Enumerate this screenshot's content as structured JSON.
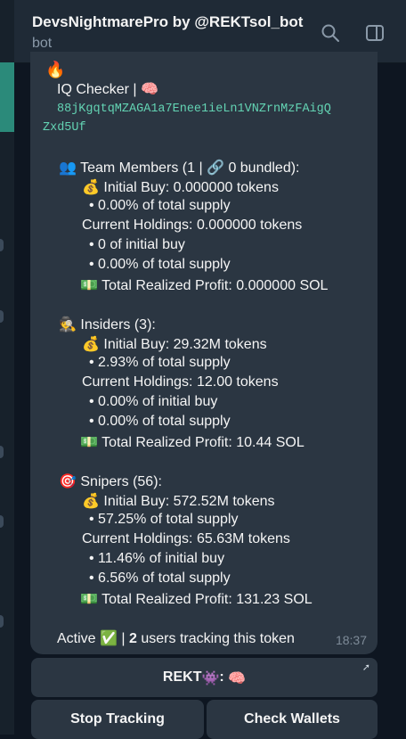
{
  "chat": {
    "title": "DevsNightmarePro by @REKTsol_bot",
    "subtitle": "bot"
  },
  "message": {
    "top_emoji": "🔥",
    "header": "IQ Checker  |",
    "header_emoji": "🧠",
    "address_line1": "88jKgqtqMZAGA1a7Enee1ieLn1VNZrnMzFAigQ",
    "address_line2": "Zxd5Uf",
    "team": {
      "icon": "👥",
      "title": "Team Members (1 |",
      "link_icon": "🔗",
      "title_tail": "0 bundled):",
      "buy_icon": "💰",
      "initial_buy": "Initial Buy: 0.000000 tokens",
      "initial_pct": "• 0.00% of total supply",
      "holdings": "Current Holdings: 0.000000 tokens",
      "hold_initial": "• 0 of initial buy",
      "hold_pct": "• 0.00% of total supply",
      "profit_icon": "💵",
      "profit": "Total Realized Profit: 0.000000 SOL"
    },
    "insiders": {
      "icon": "🕵",
      "title": "Insiders (3):",
      "buy_icon": "💰",
      "initial_buy": "Initial Buy: 29.32M tokens",
      "initial_pct": "• 2.93% of total supply",
      "holdings": "Current Holdings: 12.00 tokens",
      "hold_initial": "• 0.00% of initial buy",
      "hold_pct": "• 0.00% of total supply",
      "profit_icon": "💵",
      "profit": "Total Realized Profit: 10.44 SOL"
    },
    "snipers": {
      "icon": "🎯",
      "title": "Snipers (56):",
      "buy_icon": "💰",
      "initial_buy": "Initial Buy: 572.52M tokens",
      "initial_pct": "• 57.25% of total supply",
      "holdings": "Current Holdings: 65.63M tokens",
      "hold_initial": "• 11.46% of initial buy",
      "hold_pct": "• 6.56% of total supply",
      "profit_icon": "💵",
      "profit": "Total Realized Profit: 131.23 SOL"
    },
    "status_label": "Active",
    "status_emoji": "✅",
    "separator": "|",
    "users_count": "2",
    "users_text": "users tracking this token",
    "time": "18:37"
  },
  "buttons": {
    "rekt_label": "REKT",
    "rekt_emoji1": "👾",
    "rekt_colon": ":",
    "rekt_emoji2": "🧠",
    "stop": "Stop Tracking",
    "check": "Check Wallets"
  }
}
